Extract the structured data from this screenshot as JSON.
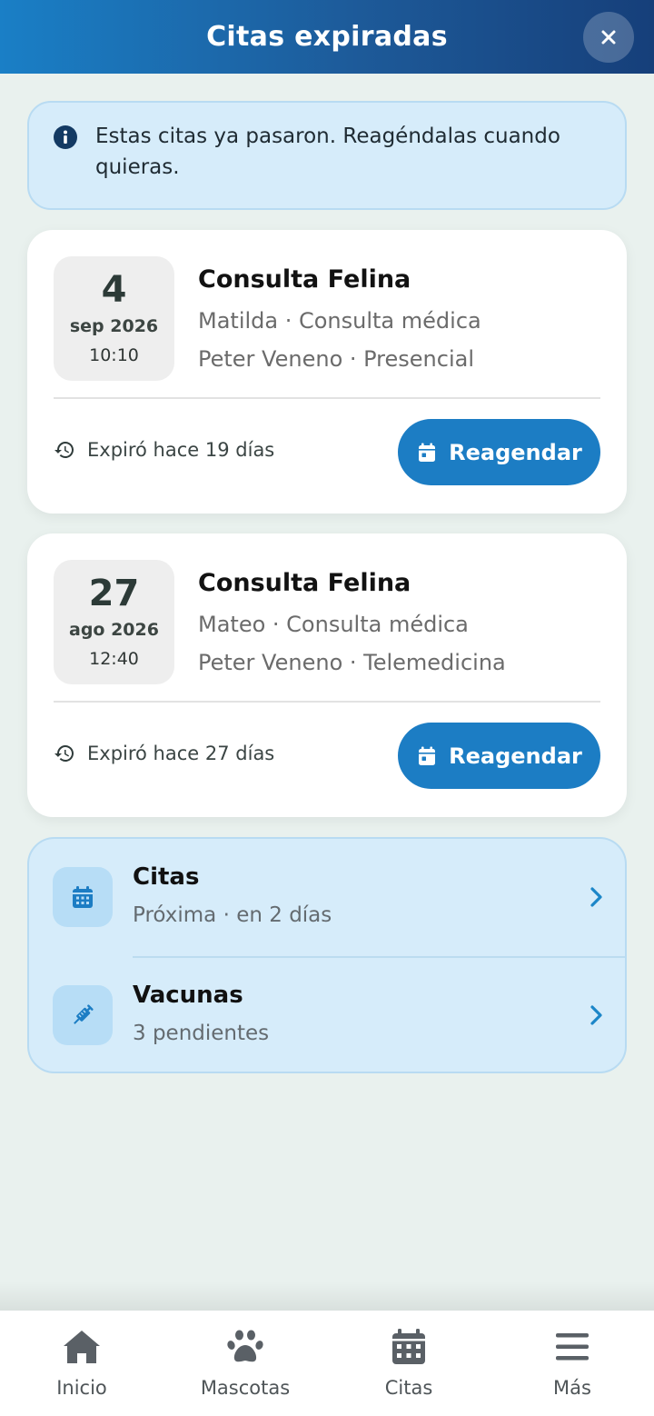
{
  "header": {
    "title": "Citas expiradas"
  },
  "info": {
    "message": "Estas citas ya pasaron. Reagéndalas cuando quieras."
  },
  "appointments": [
    {
      "day": "4",
      "month_year": "sep 2026",
      "time": "10:10",
      "title": "Consulta Felina",
      "pet_line": "Matilda · Consulta médica",
      "vet_line": "Peter Veneno · Presencial",
      "expired_text": "Expiró hace 19 días",
      "button_label": "Reagendar"
    },
    {
      "day": "27",
      "month_year": "ago 2026",
      "time": "12:40",
      "title": "Consulta Felina",
      "pet_line": "Mateo · Consulta médica",
      "vet_line": "Peter Veneno · Telemedicina",
      "expired_text": "Expiró hace 27 días",
      "button_label": "Reagendar"
    }
  ],
  "links": [
    {
      "title": "Citas",
      "subtitle": "Próxima · en 2 días",
      "icon": "calendar-icon"
    },
    {
      "title": "Vacunas",
      "subtitle": "3 pendientes",
      "icon": "syringe-icon"
    }
  ],
  "nav": [
    {
      "label": "Inicio",
      "icon": "home-icon"
    },
    {
      "label": "Mascotas",
      "icon": "paw-icon"
    },
    {
      "label": "Citas",
      "icon": "calendar-icon"
    },
    {
      "label": "Más",
      "icon": "menu-icon"
    }
  ],
  "colors": {
    "primary": "#1c7dc4",
    "background": "#e9f1ee",
    "info_bg": "#d6ecfa",
    "nav_icon": "#5a6066"
  }
}
